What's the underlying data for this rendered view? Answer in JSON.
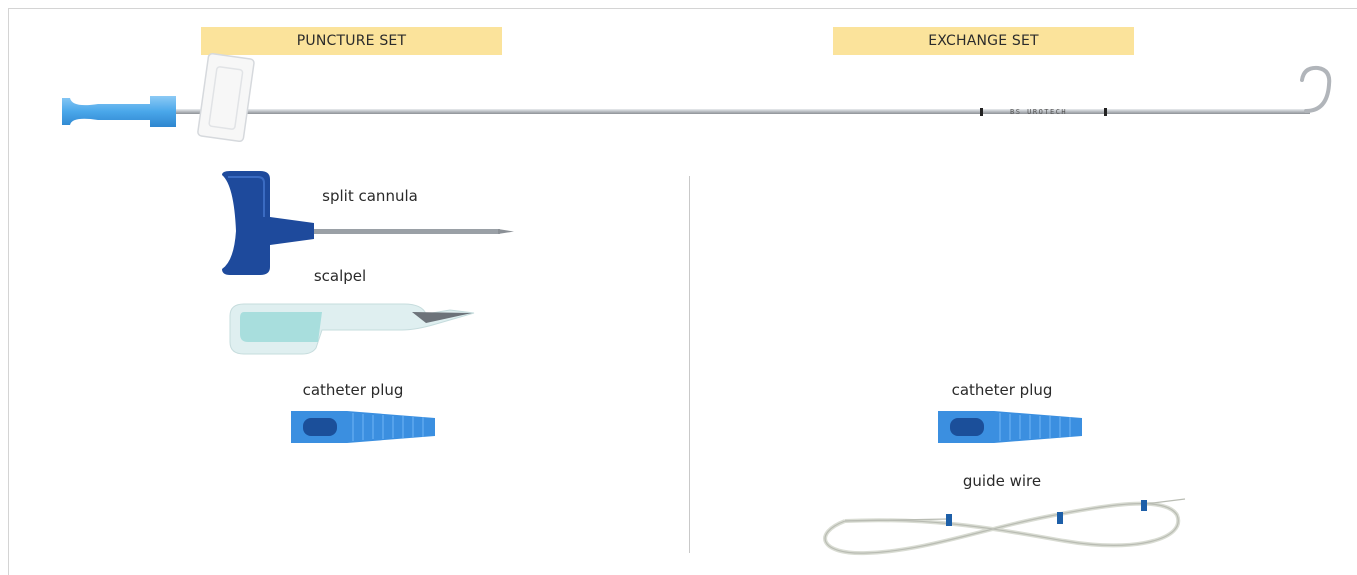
{
  "sets": {
    "puncture": {
      "title": "PUNCTURE SET"
    },
    "exchange": {
      "title": "EXCHANGE SET"
    }
  },
  "catheter": {
    "imprint": "BS UROTECH"
  },
  "items": {
    "split_cannula": "split cannula",
    "scalpel": "scalpel",
    "catheter_plug_left": "catheter plug",
    "catheter_plug_right": "catheter plug",
    "guide_wire": "guide wire"
  },
  "colors": {
    "banner": "#fbe39b",
    "plug_blue": "#3b8fe0",
    "cannula_navy": "#1e4a9c",
    "scalpel_teal": "#a8dedd",
    "wire_marker": "#1d5fa8"
  },
  "icons": [
    "catheter-image",
    "split-cannula-image",
    "scalpel-image",
    "catheter-plug-image",
    "guide-wire-image"
  ]
}
